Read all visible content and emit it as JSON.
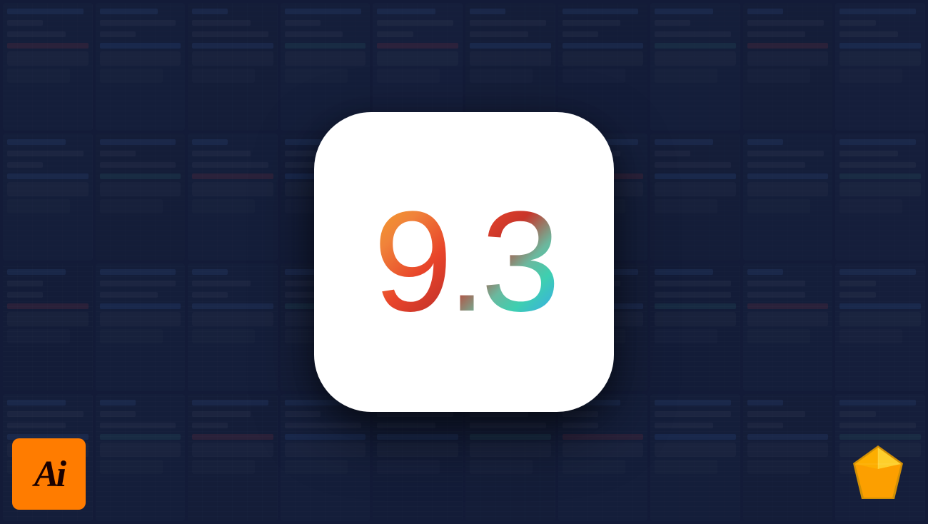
{
  "background": {
    "color": "#1a2340",
    "overlay_color": "rgba(15,22,50,0.55)"
  },
  "center_card": {
    "version_text": "9.3",
    "border_radius": "80px",
    "background": "#ffffff"
  },
  "ai_icon": {
    "label": "Ai",
    "background_color": "#FF7C00",
    "text_color": "#1a0000"
  },
  "sketch_icon": {
    "label": "Sketch",
    "primary_color": "#FDB300",
    "outline_color": "#E59B00"
  },
  "bg_cells": [
    {
      "type": "bars",
      "bars": [
        "long",
        "short",
        "medium",
        "red"
      ]
    },
    {
      "type": "bars",
      "bars": [
        "medium",
        "long",
        "short",
        "blue"
      ]
    },
    {
      "type": "bars",
      "bars": [
        "short",
        "medium",
        "long",
        "accent"
      ]
    },
    {
      "type": "bars",
      "bars": [
        "long",
        "short",
        "medium",
        "teal"
      ]
    },
    {
      "type": "bars",
      "bars": [
        "medium",
        "long",
        "short",
        "red"
      ]
    },
    {
      "type": "bars",
      "bars": [
        "short",
        "long",
        "medium",
        "blue"
      ]
    },
    {
      "type": "bars",
      "bars": [
        "long",
        "medium",
        "short",
        "accent"
      ]
    },
    {
      "type": "bars",
      "bars": [
        "medium",
        "short",
        "long",
        "teal"
      ]
    },
    {
      "type": "bars",
      "bars": [
        "short",
        "long",
        "medium",
        "red"
      ]
    },
    {
      "type": "bars",
      "bars": [
        "long",
        "short",
        "medium",
        "blue"
      ]
    },
    {
      "type": "bars",
      "bars": [
        "medium",
        "long",
        "short",
        "accent"
      ]
    },
    {
      "type": "bars",
      "bars": [
        "long",
        "short",
        "long",
        "teal"
      ]
    },
    {
      "type": "bars",
      "bars": [
        "short",
        "medium",
        "long",
        "red"
      ]
    },
    {
      "type": "bars",
      "bars": [
        "long",
        "long",
        "short",
        "blue"
      ]
    },
    {
      "type": "bars",
      "bars": [
        "medium",
        "short",
        "medium",
        "accent"
      ]
    },
    {
      "type": "bars",
      "bars": [
        "short",
        "long",
        "long",
        "teal"
      ]
    },
    {
      "type": "bars",
      "bars": [
        "long",
        "medium",
        "short",
        "red"
      ]
    },
    {
      "type": "bars",
      "bars": [
        "medium",
        "short",
        "long",
        "blue"
      ]
    },
    {
      "type": "bars",
      "bars": [
        "short",
        "long",
        "medium",
        "accent"
      ]
    },
    {
      "type": "bars",
      "bars": [
        "long",
        "medium",
        "long",
        "teal"
      ]
    },
    {
      "type": "bars",
      "bars": [
        "medium",
        "short",
        "short",
        "red"
      ]
    },
    {
      "type": "bars",
      "bars": [
        "long",
        "long",
        "medium",
        "blue"
      ]
    },
    {
      "type": "bars",
      "bars": [
        "short",
        "medium",
        "short",
        "accent"
      ]
    },
    {
      "type": "bars",
      "bars": [
        "long",
        "short",
        "long",
        "teal"
      ]
    },
    {
      "type": "bars",
      "bars": [
        "medium",
        "long",
        "medium",
        "red"
      ]
    },
    {
      "type": "bars",
      "bars": [
        "short",
        "short",
        "long",
        "blue"
      ]
    },
    {
      "type": "bars",
      "bars": [
        "long",
        "medium",
        "short",
        "accent"
      ]
    },
    {
      "type": "bars",
      "bars": [
        "medium",
        "long",
        "long",
        "teal"
      ]
    },
    {
      "type": "bars",
      "bars": [
        "short",
        "medium",
        "medium",
        "red"
      ]
    },
    {
      "type": "bars",
      "bars": [
        "long",
        "short",
        "short",
        "blue"
      ]
    },
    {
      "type": "bars",
      "bars": [
        "medium",
        "long",
        "medium",
        "accent"
      ]
    },
    {
      "type": "bars",
      "bars": [
        "short",
        "short",
        "long",
        "teal"
      ]
    },
    {
      "type": "bars",
      "bars": [
        "long",
        "medium",
        "short",
        "red"
      ]
    },
    {
      "type": "bars",
      "bars": [
        "medium",
        "short",
        "long",
        "blue"
      ]
    },
    {
      "type": "bars",
      "bars": [
        "short",
        "long",
        "medium",
        "accent"
      ]
    },
    {
      "type": "bars",
      "bars": [
        "long",
        "medium",
        "long",
        "teal"
      ]
    },
    {
      "type": "bars",
      "bars": [
        "medium",
        "short",
        "short",
        "red"
      ]
    },
    {
      "type": "bars",
      "bars": [
        "long",
        "long",
        "medium",
        "blue"
      ]
    },
    {
      "type": "bars",
      "bars": [
        "short",
        "medium",
        "short",
        "accent"
      ]
    },
    {
      "type": "bars",
      "bars": [
        "long",
        "short",
        "long",
        "teal"
      ]
    }
  ]
}
